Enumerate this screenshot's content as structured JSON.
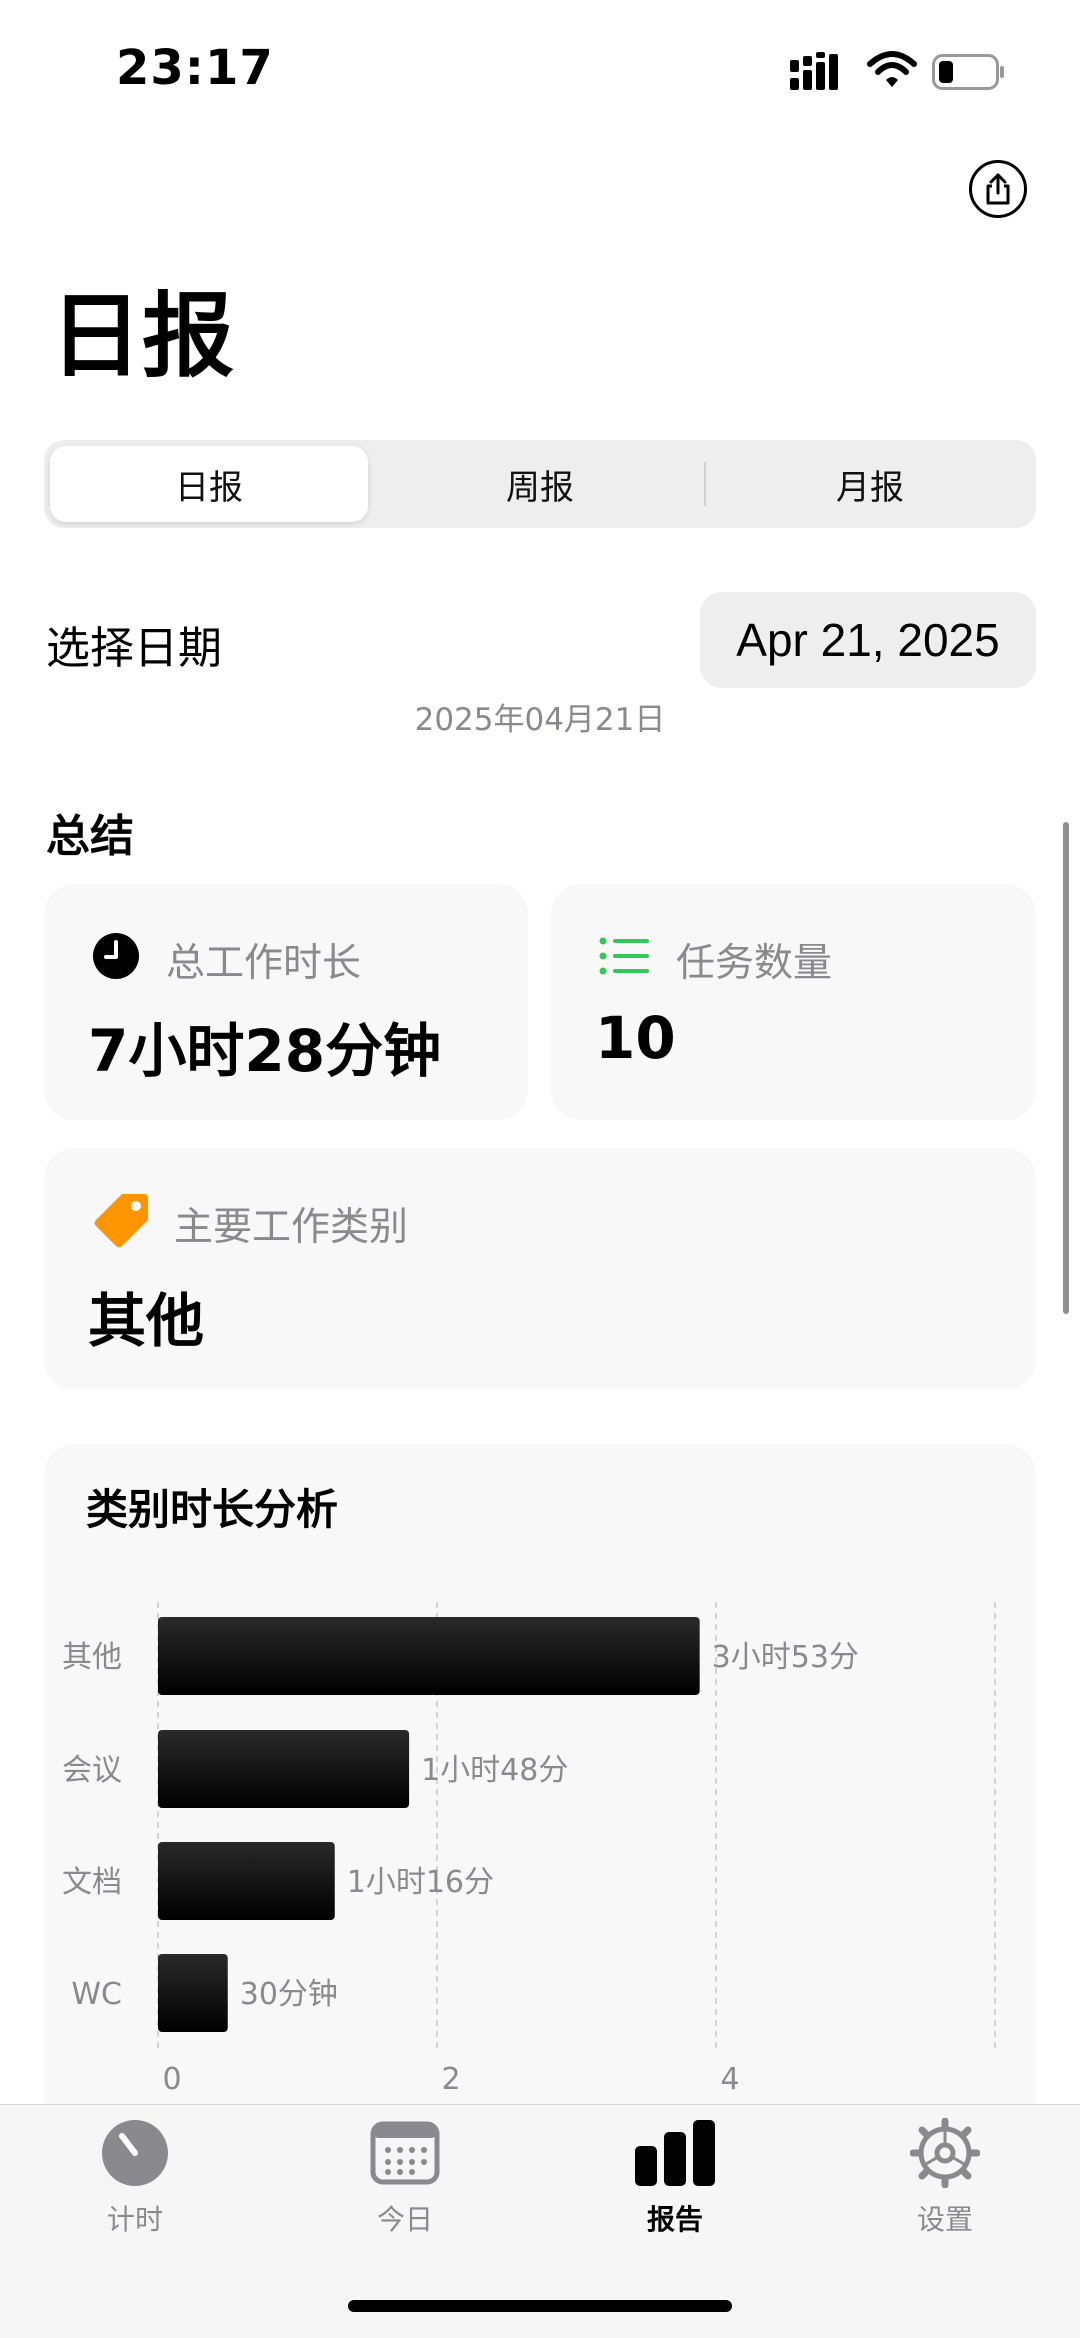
{
  "status_bar": {
    "time": "23:17"
  },
  "page": {
    "title": "日报"
  },
  "segments": {
    "items": [
      "日报",
      "周报",
      "月报"
    ],
    "selected": "日报"
  },
  "date_picker": {
    "label": "选择日期",
    "value": "Apr 21, 2025",
    "subtitle": "2025年04月21日"
  },
  "summary": {
    "title": "总结",
    "total_time": {
      "label": "总工作时长",
      "value": "7小时28分钟",
      "icon": "clock-icon"
    },
    "task_count": {
      "label": "任务数量",
      "value": "10",
      "icon": "list-icon",
      "icon_color": "#34c759"
    },
    "main_category": {
      "label": "主要工作类别",
      "value": "其他",
      "icon": "tag-icon",
      "icon_color": "#ff9500"
    }
  },
  "chart_data": {
    "type": "bar",
    "orientation": "horizontal",
    "title": "类别时长分析",
    "categories": [
      "其他",
      "会议",
      "文档",
      "WC"
    ],
    "values_hours": [
      3.883,
      1.8,
      1.267,
      0.5
    ],
    "data_labels": [
      "3小时53分",
      "1小时48分",
      "1小时16分",
      "30分钟"
    ],
    "x_ticks": [
      "0",
      "2",
      "4"
    ],
    "xlim": [
      0,
      6
    ],
    "grid": true,
    "bar_color": "#000000"
  },
  "tabbar": {
    "items": [
      {
        "label": "计时",
        "icon": "timer-icon"
      },
      {
        "label": "今日",
        "icon": "calendar-icon"
      },
      {
        "label": "报告",
        "icon": "bar-chart-icon"
      },
      {
        "label": "设置",
        "icon": "gear-icon"
      }
    ],
    "selected": "报告"
  }
}
